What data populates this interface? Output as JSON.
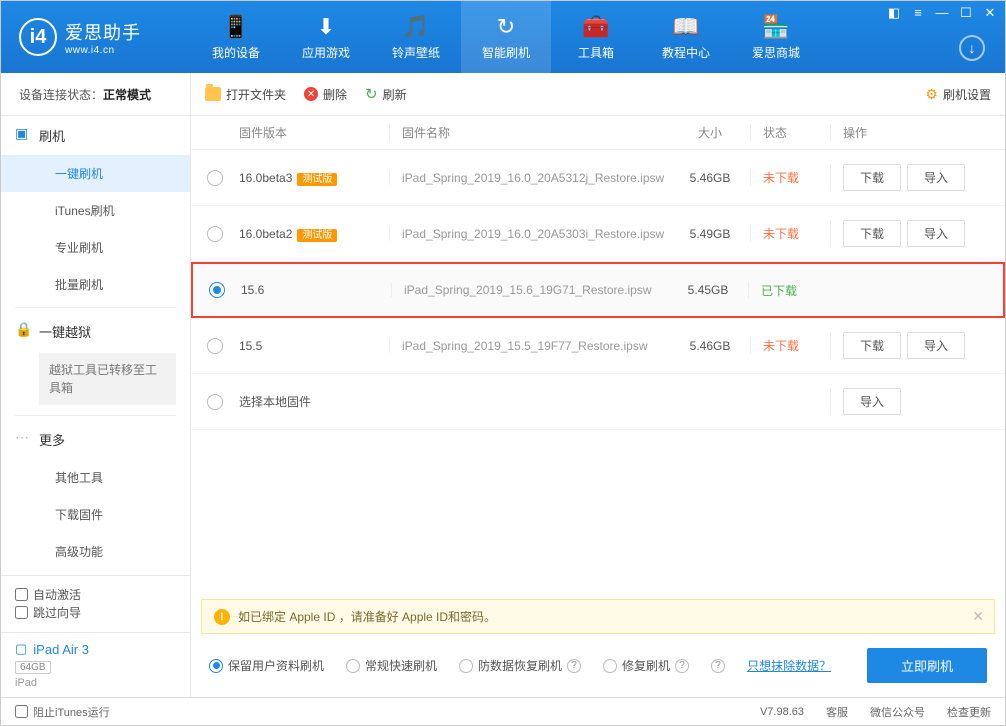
{
  "app": {
    "name": "爱思助手",
    "url": "www.i4.cn"
  },
  "nav": [
    {
      "label": "我的设备",
      "icon": "📱"
    },
    {
      "label": "应用游戏",
      "icon": "⬇"
    },
    {
      "label": "铃声壁纸",
      "icon": "🎵"
    },
    {
      "label": "智能刷机",
      "icon": "↻",
      "active": true
    },
    {
      "label": "工具箱",
      "icon": "🧰"
    },
    {
      "label": "教程中心",
      "icon": "📖"
    },
    {
      "label": "爱思商城",
      "icon": "🏪"
    }
  ],
  "connection": {
    "label": "设备连接状态：",
    "value": "正常模式"
  },
  "toolbar": {
    "open": "打开文件夹",
    "delete": "删除",
    "refresh": "刷新",
    "settings": "刷机设置"
  },
  "sidebar": {
    "flash": {
      "title": "刷机",
      "items": [
        "一键刷机",
        "iTunes刷机",
        "专业刷机",
        "批量刷机"
      ]
    },
    "jailbreak": {
      "title": "一键越狱",
      "note": "越狱工具已转移至工具箱"
    },
    "more": {
      "title": "更多",
      "items": [
        "其他工具",
        "下载固件",
        "高级功能"
      ]
    },
    "auto_activate": "自动激活",
    "skip_guide": "跳过向导",
    "device": {
      "name": "iPad Air 3",
      "storage": "64GB",
      "type": "iPad",
      "icon": "⊞"
    }
  },
  "columns": {
    "version": "固件版本",
    "name": "固件名称",
    "size": "大小",
    "status": "状态",
    "ops": "操作"
  },
  "buttons": {
    "download": "下载",
    "import": "导入"
  },
  "status_text": {
    "no": "未下载",
    "yes": "已下载"
  },
  "firmware": [
    {
      "version": "16.0beta3",
      "badge": "测试版",
      "name": "iPad_Spring_2019_16.0_20A5312j_Restore.ipsw",
      "size": "5.46GB",
      "downloaded": false,
      "selected": false
    },
    {
      "version": "16.0beta2",
      "badge": "测试版",
      "name": "iPad_Spring_2019_16.0_20A5303i_Restore.ipsw",
      "size": "5.49GB",
      "downloaded": false,
      "selected": false
    },
    {
      "version": "15.6",
      "badge": "",
      "name": "iPad_Spring_2019_15.6_19G71_Restore.ipsw",
      "size": "5.45GB",
      "downloaded": true,
      "selected": true
    },
    {
      "version": "15.5",
      "badge": "",
      "name": "iPad_Spring_2019_15.5_19F77_Restore.ipsw",
      "size": "5.46GB",
      "downloaded": false,
      "selected": false
    }
  ],
  "local_firmware": "选择本地固件",
  "alert": "如已绑定 Apple ID ，请准备好 Apple ID和密码。",
  "options": {
    "items": [
      "保留用户资料刷机",
      "常规快速刷机",
      "防数据恢复刷机",
      "修复刷机"
    ],
    "erase_link": "只想抹除数据？",
    "flash_now": "立即刷机"
  },
  "statusbar": {
    "block_itunes": "阻止iTunes运行",
    "version": "V7.98.63",
    "service": "客服",
    "wechat": "微信公众号",
    "update": "检查更新"
  }
}
